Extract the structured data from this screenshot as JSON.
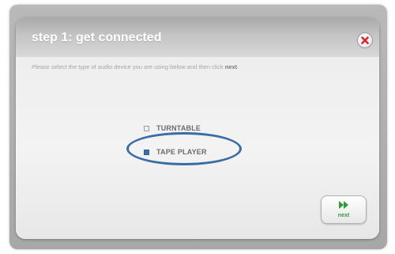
{
  "dialog": {
    "title": "step 1: get connected",
    "instruction_prefix": "Please select the type of audio device you are using below and then click ",
    "instruction_emphasis": "next",
    "instruction_suffix": "."
  },
  "options": [
    {
      "label": "TURNTABLE",
      "selected": false
    },
    {
      "label": "TAPE PLAYER",
      "selected": true
    }
  ],
  "next_button": {
    "label": "next",
    "icon": "fast-forward-icon"
  },
  "close_button": {
    "icon": "close-icon"
  },
  "colors": {
    "accent": "#3a6ca5",
    "next_green": "#2f9a3c",
    "close_red": "#d4262f"
  }
}
